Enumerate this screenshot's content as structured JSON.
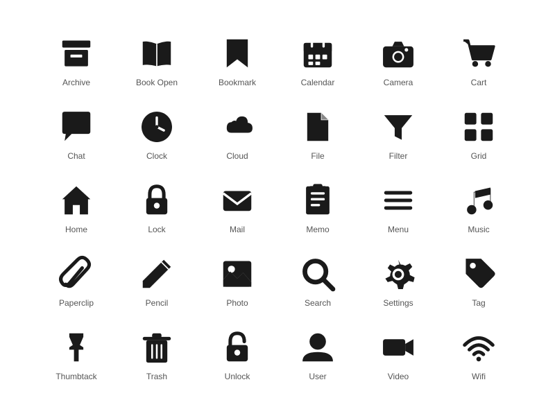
{
  "icons": [
    {
      "name": "archive-icon",
      "label": "Archive"
    },
    {
      "name": "book-open-icon",
      "label": "Book Open"
    },
    {
      "name": "bookmark-icon",
      "label": "Bookmark"
    },
    {
      "name": "calendar-icon",
      "label": "Calendar"
    },
    {
      "name": "camera-icon",
      "label": "Camera"
    },
    {
      "name": "cart-icon",
      "label": "Cart"
    },
    {
      "name": "chat-icon",
      "label": "Chat"
    },
    {
      "name": "clock-icon",
      "label": "Clock"
    },
    {
      "name": "cloud-icon",
      "label": "Cloud"
    },
    {
      "name": "file-icon",
      "label": "File"
    },
    {
      "name": "filter-icon",
      "label": "Filter"
    },
    {
      "name": "grid-icon",
      "label": "Grid"
    },
    {
      "name": "home-icon",
      "label": "Home"
    },
    {
      "name": "lock-icon",
      "label": "Lock"
    },
    {
      "name": "mail-icon",
      "label": "Mail"
    },
    {
      "name": "memo-icon",
      "label": "Memo"
    },
    {
      "name": "menu-icon",
      "label": "Menu"
    },
    {
      "name": "music-icon",
      "label": "Music"
    },
    {
      "name": "paperclip-icon",
      "label": "Paperclip"
    },
    {
      "name": "pencil-icon",
      "label": "Pencil"
    },
    {
      "name": "photo-icon",
      "label": "Photo"
    },
    {
      "name": "search-icon",
      "label": "Search"
    },
    {
      "name": "settings-icon",
      "label": "Settings"
    },
    {
      "name": "tag-icon",
      "label": "Tag"
    },
    {
      "name": "thumbtack-icon",
      "label": "Thumbtack"
    },
    {
      "name": "trash-icon",
      "label": "Trash"
    },
    {
      "name": "unlock-icon",
      "label": "Unlock"
    },
    {
      "name": "user-icon",
      "label": "User"
    },
    {
      "name": "video-icon",
      "label": "Video"
    },
    {
      "name": "wifi-icon",
      "label": "Wifi"
    }
  ]
}
